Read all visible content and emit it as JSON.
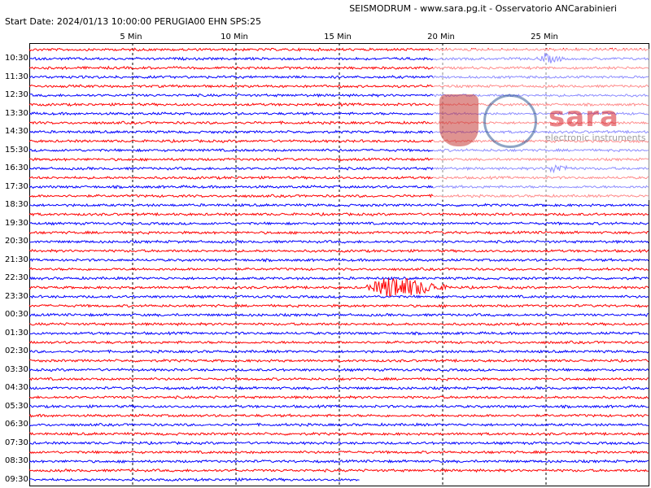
{
  "header": {
    "station_title": "SEISMODRUM - www.sara.pg.it - Osservatorio ANCarabinieri",
    "start_info": "Start Date: 2024/01/13 10:00:00 PERUGIA00 EHN  SPS:25"
  },
  "watermark": {
    "brand": "sara",
    "tagline": "electronic instruments",
    "emblem_icon": "carabinieri-shield-icon",
    "globe_icon": "observatory-globe-icon"
  },
  "colors": {
    "odd_trace": "#ff0000",
    "even_trace": "#0000ff",
    "grid": "#000000"
  },
  "chart_data": {
    "type": "line",
    "title": "",
    "xlabel": "",
    "ylabel": "",
    "x_tick_labels": [
      "5 Min",
      "10 Min",
      "15 Min",
      "20 Min",
      "25 Min"
    ],
    "x_ticks_minutes": [
      5,
      10,
      15,
      20,
      25
    ],
    "xlim_minutes": [
      0,
      30
    ],
    "traces_per_hour": 2,
    "trace_colors_alternate": [
      "red",
      "blue"
    ],
    "hour_labels": [
      "10:30",
      "11:30",
      "12:30",
      "13:30",
      "14:30",
      "15:30",
      "16:30",
      "17:30",
      "18:30",
      "19:30",
      "20:30",
      "21:30",
      "22:30",
      "23:30",
      "00:30",
      "01:30",
      "02:30",
      "03:30",
      "04:30",
      "05:30",
      "06:30",
      "07:30",
      "08:30",
      "09:30"
    ],
    "trace_count": 48,
    "last_trace_end_minute": 16,
    "events": [
      {
        "trace_index": 26,
        "start_minute": 16.2,
        "peak_minute": 17.5,
        "end_minute": 20.5,
        "relative_amplitude": 1.0,
        "label_near": "23:30"
      },
      {
        "trace_index": 1,
        "start_minute": 24.5,
        "peak_minute": 25,
        "end_minute": 26,
        "relative_amplitude": 0.35,
        "label_near": "10:30"
      },
      {
        "trace_index": 13,
        "start_minute": 25,
        "peak_minute": 25.4,
        "end_minute": 26.5,
        "relative_amplitude": 0.35,
        "label_near": "16:30"
      }
    ],
    "grid": "dashed vertical lines at tick minutes",
    "legend": "none"
  }
}
